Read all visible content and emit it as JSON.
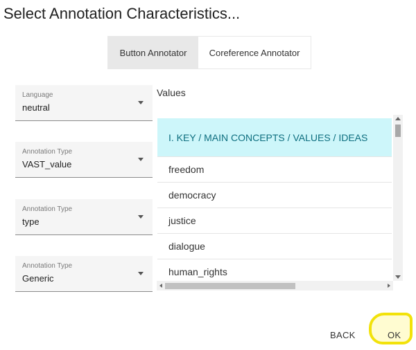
{
  "dialog": {
    "title": "Select Annotation Characteristics..."
  },
  "tabs": [
    {
      "label": "Button Annotator",
      "active": true
    },
    {
      "label": "Coreference Annotator",
      "active": false
    }
  ],
  "fields": [
    {
      "label": "Language",
      "value": "neutral"
    },
    {
      "label": "Annotation Type",
      "value": "VAST_value"
    },
    {
      "label": "Annotation Type",
      "value": "type"
    },
    {
      "label": "Annotation Type",
      "value": "Generic"
    }
  ],
  "values": {
    "title": "Values",
    "items": [
      "I. KEY / MAIN CONCEPTS / VALUES / IDEAS",
      "freedom",
      "democracy",
      "justice",
      "dialogue",
      "human_rights"
    ]
  },
  "actions": {
    "back_label": "BACK",
    "ok_label": "OK"
  },
  "colors": {
    "header_item_bg": "#cdf6fa",
    "header_item_text": "#0d6e7f",
    "highlight": "#f2e20a"
  }
}
